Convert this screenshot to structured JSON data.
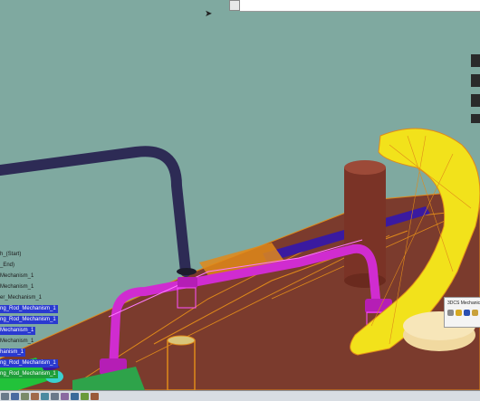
{
  "window": {
    "title": "",
    "popup_title": "3DCS Mechanica"
  },
  "spec_tree": {
    "items": [
      {
        "label": "h_(Start)",
        "style": "plain"
      },
      {
        "label": "_End)",
        "style": "plain"
      },
      {
        "label": "Mechanism_1",
        "style": "plain"
      },
      {
        "label": "Mechanism_1",
        "style": "plain"
      },
      {
        "label": "er_Mechanism_1",
        "style": "plain"
      },
      {
        "label": "ng_Rod_Mechanism_1",
        "style": "sel"
      },
      {
        "label": "ng_Rod_Mechanism_1",
        "style": "sel"
      },
      {
        "label": "Mechanism_1",
        "style": "sel"
      },
      {
        "label": "Mechanism_1",
        "style": "plain"
      },
      {
        "label": "hanism_1",
        "style": "sel"
      },
      {
        "label": "ng_Rod_Mechanism_1",
        "style": "sel"
      },
      {
        "label": "ng_Rod_Mechanism_1",
        "style": "grn"
      }
    ]
  },
  "colors": {
    "background": "#7fa9a0",
    "rod_dark": "#2d2b55",
    "rod_magenta": "#d02cd0",
    "yellow_part": "#f2e21b",
    "base_plate": "#7b3b2d",
    "orange_wire": "#e08a1a",
    "purple_strip": "#3a1aa0",
    "green_part": "#22c23a"
  },
  "statusbar": {
    "icons": [
      "tool-icon",
      "tool-icon",
      "tool-icon",
      "tool-icon",
      "tool-icon",
      "tool-icon",
      "tool-icon",
      "tool-icon",
      "tool-icon",
      "tool-icon"
    ]
  }
}
